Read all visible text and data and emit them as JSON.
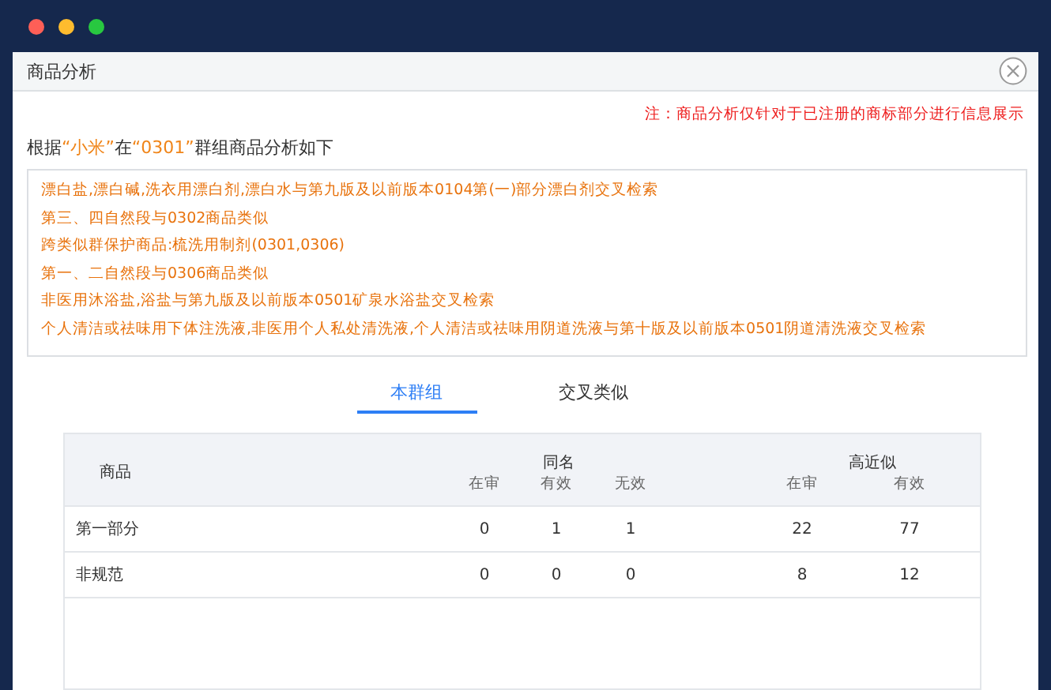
{
  "dialog": {
    "title": "商品分析"
  },
  "note": "注：商品分析仅针对于已注册的商标部分进行信息展示",
  "intro": [
    {
      "text": "根据",
      "highlight": false
    },
    {
      "text": "“小米”",
      "highlight": true
    },
    {
      "text": "在",
      "highlight": false
    },
    {
      "text": "“0301”",
      "highlight": true
    },
    {
      "text": "群组商品分析如下",
      "highlight": false
    }
  ],
  "analysis_lines": [
    "漂白盐,漂白碱,洗衣用漂白剂,漂白水与第九版及以前版本0104第(一)部分漂白剂交叉检索",
    "第三、四自然段与0302商品类似",
    "跨类似群保护商品:梳洗用制剂(0301,0306)",
    "第一、二自然段与0306商品类似",
    "非医用沐浴盐,浴盐与第九版及以前版本0501矿泉水浴盐交叉检索",
    "个人清洁或祛味用下体注洗液,非医用个人私处清洗液,个人清洁或祛味用阴道洗液与第十版及以前版本0501阴道清洗液交叉检索"
  ],
  "tabs": [
    {
      "label": "本群组",
      "selected": true
    },
    {
      "label": "交叉类似",
      "selected": false
    }
  ],
  "table": {
    "name_column": "商品",
    "groups": [
      {
        "label": "同名",
        "columns": [
          "在审",
          "有效",
          "无效"
        ]
      },
      {
        "label": "高近似",
        "columns": [
          "在审",
          "有效"
        ]
      }
    ],
    "rows": [
      {
        "name": "第一部分",
        "values": [
          "0",
          "1",
          "1",
          "22",
          "77"
        ]
      },
      {
        "name": "非规范",
        "values": [
          "0",
          "0",
          "0",
          "8",
          "12"
        ]
      }
    ]
  }
}
